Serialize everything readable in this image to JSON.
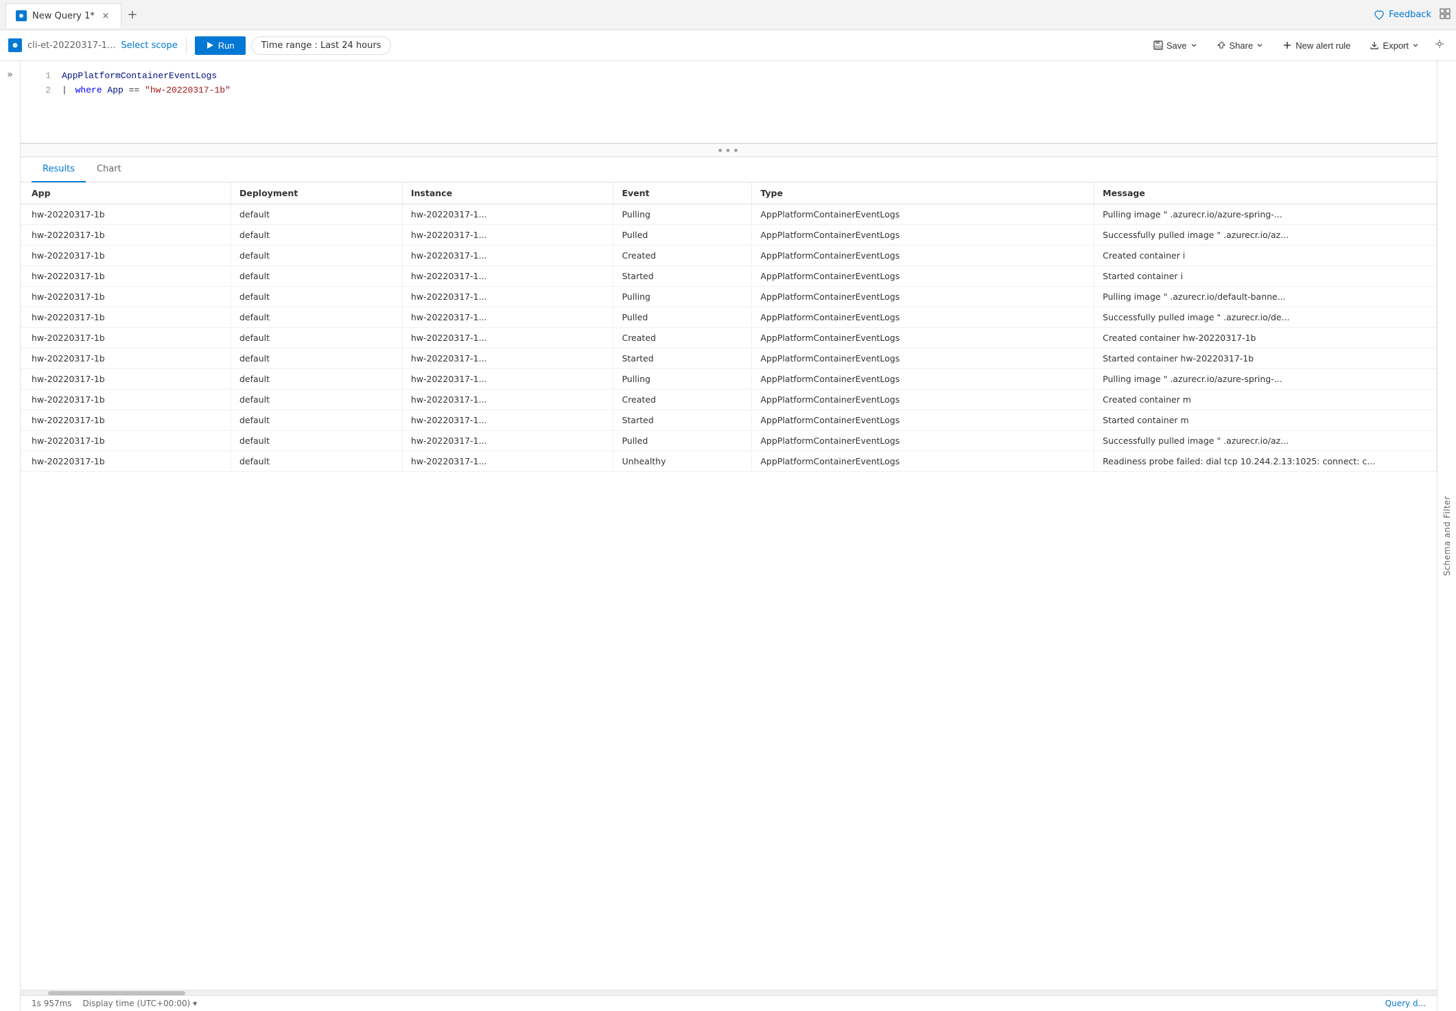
{
  "tab": {
    "title": "New Query 1*",
    "close_label": "×",
    "new_tab_label": "+"
  },
  "feedback": {
    "label": "Feedback"
  },
  "toolbar": {
    "scope_name": "cli-et-20220317-1...",
    "select_scope_label": "Select scope",
    "run_label": "Run",
    "time_range_label": "Time range : Last 24 hours",
    "save_label": "Save",
    "share_label": "Share",
    "new_alert_label": "New alert rule",
    "export_label": "Export"
  },
  "editor": {
    "lines": [
      {
        "num": "1",
        "content": "AppPlatformContainerEventLogs"
      },
      {
        "num": "2",
        "content": "| where App == \"hw-20220317-1b\""
      }
    ]
  },
  "resizer": {
    "symbol": "•••"
  },
  "results": {
    "tabs": [
      "Results",
      "Chart"
    ],
    "active_tab": "Results",
    "columns": [
      "App",
      "Deployment",
      "Instance",
      "Event",
      "Type",
      "Message"
    ],
    "rows": [
      {
        "app": "hw-20220317-1b",
        "deployment": "default",
        "instance": "hw-20220317-1...",
        "event": "Pulling",
        "type": "AppPlatformContainerEventLogs",
        "message": "Pulling image \"  .azurecr.io/azure-spring-..."
      },
      {
        "app": "hw-20220317-1b",
        "deployment": "default",
        "instance": "hw-20220317-1...",
        "event": "Pulled",
        "type": "AppPlatformContainerEventLogs",
        "message": "Successfully pulled image \"  .azurecr.io/az..."
      },
      {
        "app": "hw-20220317-1b",
        "deployment": "default",
        "instance": "hw-20220317-1...",
        "event": "Created",
        "type": "AppPlatformContainerEventLogs",
        "message": "Created container i"
      },
      {
        "app": "hw-20220317-1b",
        "deployment": "default",
        "instance": "hw-20220317-1...",
        "event": "Started",
        "type": "AppPlatformContainerEventLogs",
        "message": "Started container i"
      },
      {
        "app": "hw-20220317-1b",
        "deployment": "default",
        "instance": "hw-20220317-1...",
        "event": "Pulling",
        "type": "AppPlatformContainerEventLogs",
        "message": "Pulling image \"  .azurecr.io/default-banne..."
      },
      {
        "app": "hw-20220317-1b",
        "deployment": "default",
        "instance": "hw-20220317-1...",
        "event": "Pulled",
        "type": "AppPlatformContainerEventLogs",
        "message": "Successfully pulled image \"  .azurecr.io/de..."
      },
      {
        "app": "hw-20220317-1b",
        "deployment": "default",
        "instance": "hw-20220317-1...",
        "event": "Created",
        "type": "AppPlatformContainerEventLogs",
        "message": "Created container hw-20220317-1b"
      },
      {
        "app": "hw-20220317-1b",
        "deployment": "default",
        "instance": "hw-20220317-1...",
        "event": "Started",
        "type": "AppPlatformContainerEventLogs",
        "message": "Started container hw-20220317-1b"
      },
      {
        "app": "hw-20220317-1b",
        "deployment": "default",
        "instance": "hw-20220317-1...",
        "event": "Pulling",
        "type": "AppPlatformContainerEventLogs",
        "message": "Pulling image \"  .azurecr.io/azure-spring-..."
      },
      {
        "app": "hw-20220317-1b",
        "deployment": "default",
        "instance": "hw-20220317-1...",
        "event": "Created",
        "type": "AppPlatformContainerEventLogs",
        "message": "Created container m"
      },
      {
        "app": "hw-20220317-1b",
        "deployment": "default",
        "instance": "hw-20220317-1...",
        "event": "Started",
        "type": "AppPlatformContainerEventLogs",
        "message": "Started container m"
      },
      {
        "app": "hw-20220317-1b",
        "deployment": "default",
        "instance": "hw-20220317-1...",
        "event": "Pulled",
        "type": "AppPlatformContainerEventLogs",
        "message": "Successfully pulled image \"  .azurecr.io/az..."
      },
      {
        "app": "hw-20220317-1b",
        "deployment": "default",
        "instance": "hw-20220317-1...",
        "event": "Unhealthy",
        "type": "AppPlatformContainerEventLogs",
        "message": "Readiness probe failed: dial tcp 10.244.2.13:1025: connect: c..."
      }
    ]
  },
  "right_sidebar": {
    "label": "Schema and Filter"
  },
  "status_bar": {
    "duration": "1s 957ms",
    "display_time": "Display time (UTC+00:00)",
    "query_details": "Query d..."
  }
}
